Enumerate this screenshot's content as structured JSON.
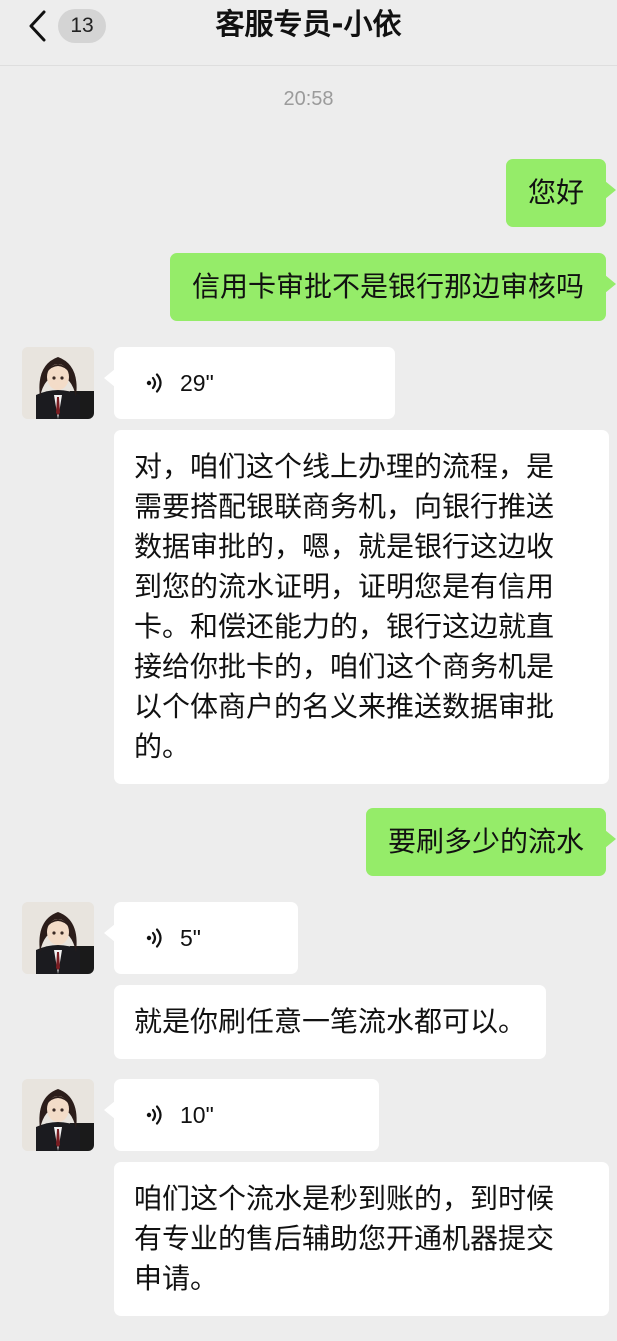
{
  "header": {
    "back_badge": "13",
    "title": "客服专员-小依"
  },
  "chat": {
    "timestamp": "20:58",
    "messages": [
      {
        "from": "self",
        "type": "text",
        "text": "您好"
      },
      {
        "from": "self",
        "type": "text",
        "text": "信用卡审批不是银行那边审核吗"
      },
      {
        "from": "other",
        "type": "voice",
        "duration": "29\""
      },
      {
        "from": "other",
        "type": "text",
        "lines": [
          "对，咱们这个线上办理的流程，是",
          "需要搭配银联商务机，向银行推送",
          "数据审批的，嗯，就是银行这边收",
          "到您的流水证明，证明您是有信用",
          "卡。和偿还能力的，银行这边就直",
          "接给你批卡的，咱们这个商务机是",
          "以个体商户的名义来推送数据审批",
          "的。"
        ]
      },
      {
        "from": "self",
        "type": "text",
        "text": "要刷多少的流水"
      },
      {
        "from": "other",
        "type": "voice",
        "duration": "5\""
      },
      {
        "from": "other",
        "type": "text",
        "text": "就是你刷任意一笔流水都可以。"
      },
      {
        "from": "other",
        "type": "voice",
        "duration": "10\""
      },
      {
        "from": "other",
        "type": "text",
        "lines": [
          "咱们这个流水是秒到账的，到时候",
          "有专业的售后辅助您开通机器提交",
          "申请。"
        ]
      }
    ]
  },
  "colors": {
    "background": "#ededed",
    "self_bubble": "#95ec69",
    "other_bubble": "#ffffff",
    "timestamp": "#9b9b9b"
  },
  "icons": {
    "back": "chevron-left-icon",
    "voice": "voice-wave-icon",
    "avatar": "agent-avatar"
  }
}
